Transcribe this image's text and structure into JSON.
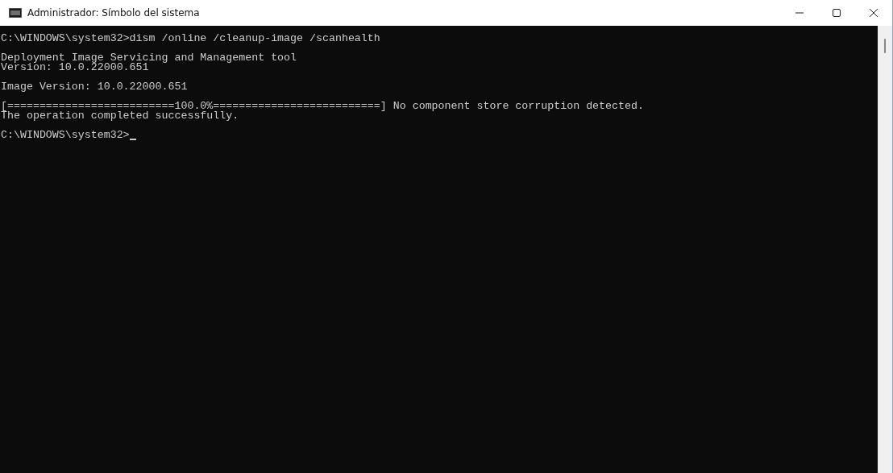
{
  "window": {
    "title": "Administrador: Símbolo del sistema"
  },
  "console": {
    "blocks": [
      [
        "C:\\WINDOWS\\system32>dism /online /cleanup-image /scanhealth"
      ],
      [
        "Deployment Image Servicing and Management tool",
        "Version: 10.0.22000.651"
      ],
      [
        "Image Version: 10.0.22000.651"
      ],
      [
        "[==========================100.0%==========================] No component store corruption detected.",
        "The operation completed successfully."
      ],
      [
        "C:\\WINDOWS\\system32>"
      ]
    ]
  }
}
